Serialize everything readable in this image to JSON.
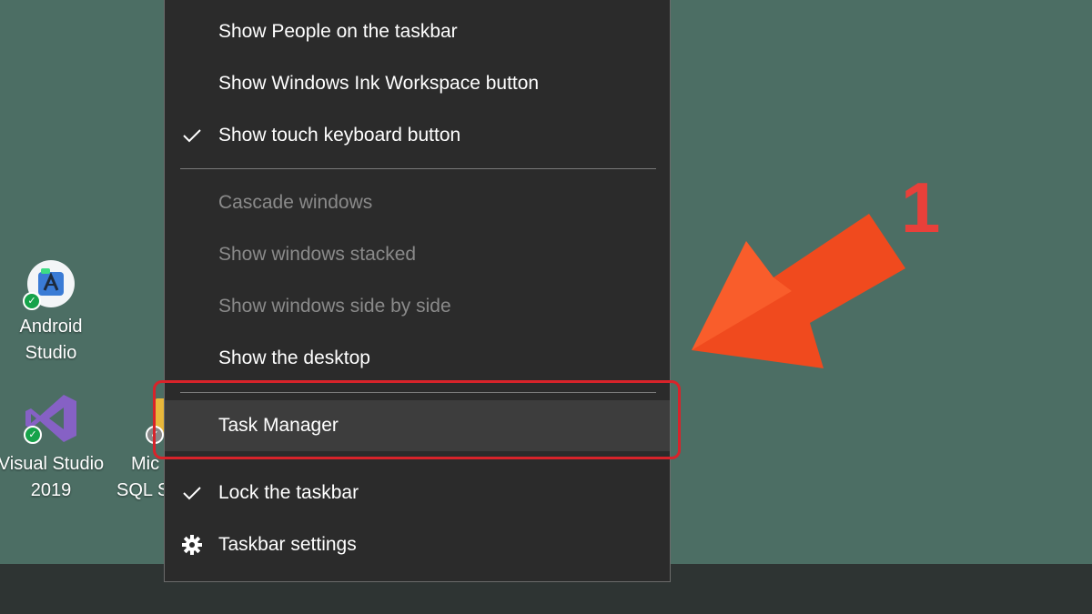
{
  "desktop": {
    "icons": [
      {
        "label_line1": "Android",
        "label_line2": "Studio",
        "icon": "android-studio-icon"
      },
      {
        "label_line1": "Visual Studio",
        "label_line2": "2019",
        "icon": "visual-studio-icon"
      },
      {
        "label_line1": "Mic",
        "label_line2": "SQL S",
        "icon": "sql-server-icon"
      }
    ]
  },
  "context_menu": {
    "items": [
      {
        "label": "Show People on the taskbar",
        "state": "enabled",
        "checked": false
      },
      {
        "label": "Show Windows Ink Workspace button",
        "state": "enabled",
        "checked": false
      },
      {
        "label": "Show touch keyboard button",
        "state": "enabled",
        "checked": true
      },
      {
        "label": "Cascade windows",
        "state": "disabled",
        "checked": false
      },
      {
        "label": "Show windows stacked",
        "state": "disabled",
        "checked": false
      },
      {
        "label": "Show windows side by side",
        "state": "disabled",
        "checked": false
      },
      {
        "label": "Show the desktop",
        "state": "enabled",
        "checked": false
      },
      {
        "label": "Task Manager",
        "state": "highlighted",
        "checked": false
      },
      {
        "label": "Lock the taskbar",
        "state": "enabled",
        "checked": true
      },
      {
        "label": "Taskbar settings",
        "state": "enabled",
        "icon": "gear-icon"
      }
    ]
  },
  "annotation": {
    "step_number": "1",
    "color": "#e8403a",
    "box_color": "#d8232a"
  },
  "colors": {
    "desktop_bg": "#4c6e64",
    "menu_bg": "#2b2b2b",
    "menu_text": "#ffffff",
    "menu_text_disabled": "#8a8a8a",
    "taskbar_bg": "#2e3433"
  }
}
